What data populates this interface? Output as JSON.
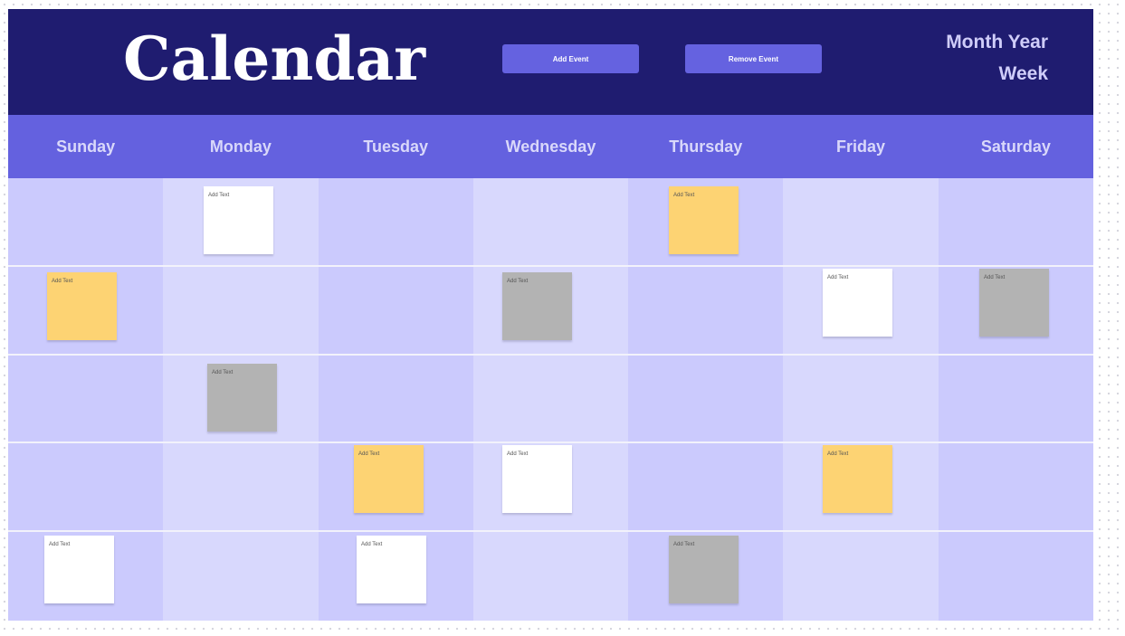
{
  "header": {
    "title": "Calendar",
    "add_event_label": "Add Event",
    "remove_event_label": "Remove Event",
    "month_year": "Month Year",
    "week": "Week"
  },
  "days": [
    "Sunday",
    "Monday",
    "Tuesday",
    "Wednesday",
    "Thursday",
    "Friday",
    "Saturday"
  ],
  "colors": {
    "header_bg": "#1f1c70",
    "day_bar_bg": "#6461df",
    "button_bg": "#6562e0",
    "cell_dark": "#cbcafd",
    "cell_light": "#d8d8fd",
    "note_white": "#ffffff",
    "note_yellow": "#fdd373",
    "note_gray": "#b3b3b3"
  },
  "notes": [
    {
      "week": 1,
      "day": "Monday",
      "color": "white",
      "text": "Add Text"
    },
    {
      "week": 1,
      "day": "Thursday",
      "color": "yellow",
      "text": "Add Text"
    },
    {
      "week": 2,
      "day": "Sunday",
      "color": "yellow",
      "text": "Add Text"
    },
    {
      "week": 2,
      "day": "Wednesday",
      "color": "gray",
      "text": "Add Text"
    },
    {
      "week": 2,
      "day": "Friday",
      "color": "white",
      "text": "Add Text"
    },
    {
      "week": 2,
      "day": "Saturday",
      "color": "gray",
      "text": "Add Text"
    },
    {
      "week": 3,
      "day": "Monday",
      "color": "gray",
      "text": "Add Text"
    },
    {
      "week": 4,
      "day": "Tuesday",
      "color": "yellow",
      "text": "Add Text"
    },
    {
      "week": 4,
      "day": "Wednesday",
      "color": "white",
      "text": "Add Text"
    },
    {
      "week": 4,
      "day": "Friday",
      "color": "yellow",
      "text": "Add Text"
    },
    {
      "week": 5,
      "day": "Sunday",
      "color": "white",
      "text": "Add Text"
    },
    {
      "week": 5,
      "day": "Tuesday",
      "color": "white",
      "text": "Add Text"
    },
    {
      "week": 5,
      "day": "Thursday",
      "color": "gray",
      "text": "Add Text"
    }
  ]
}
